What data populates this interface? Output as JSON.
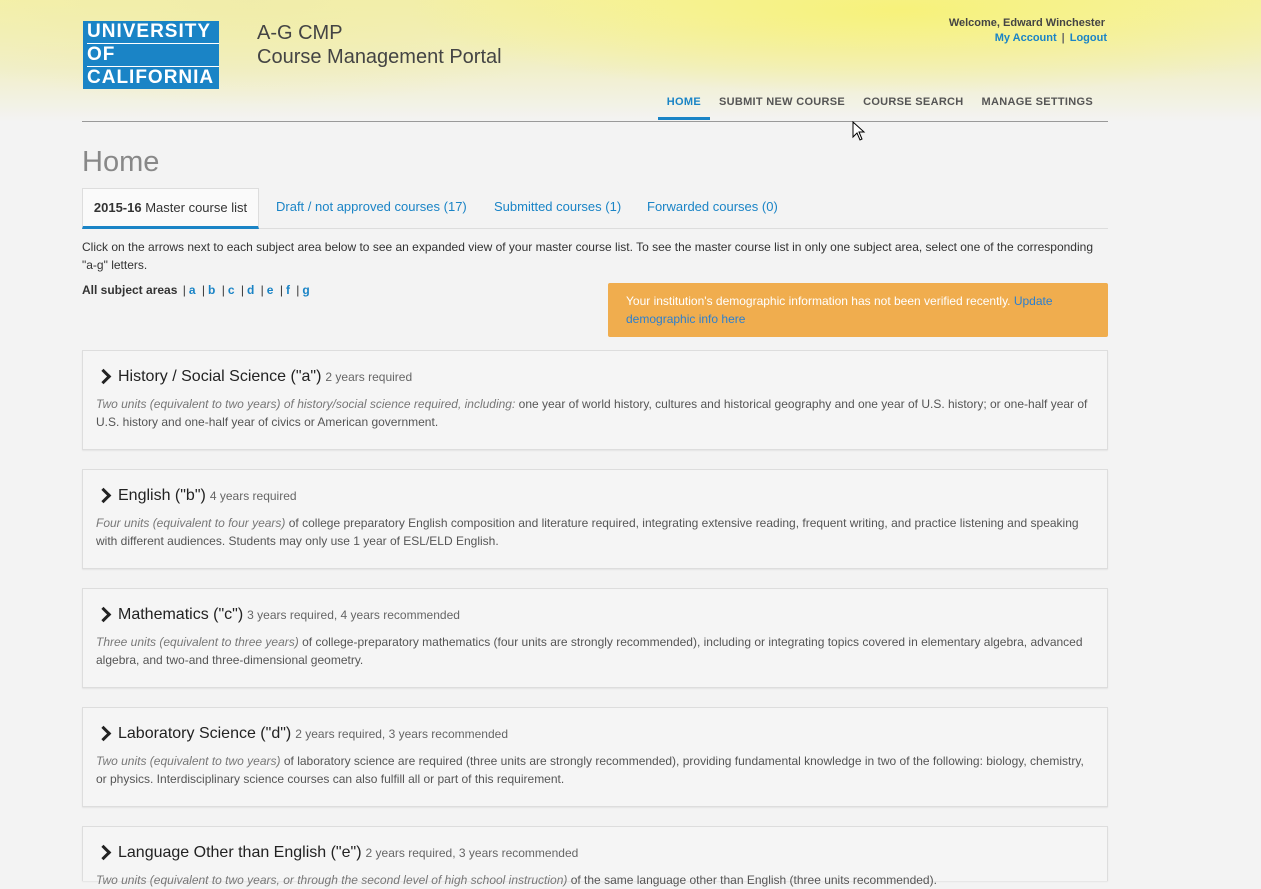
{
  "logo": {
    "lines": [
      "UNIVERSITY",
      "OF",
      "CALIFORNIA"
    ]
  },
  "app": {
    "title_line1": "A-G CMP",
    "title_line2": "Course Management Portal"
  },
  "user": {
    "welcome": "Welcome, Edward Winchester",
    "my_account": "My Account",
    "separator": "|",
    "logout": "Logout"
  },
  "nav": {
    "items": [
      "HOME",
      "SUBMIT NEW COURSE",
      "COURSE SEARCH",
      "MANAGE SETTINGS"
    ],
    "active": "HOME"
  },
  "page": {
    "title": "Home"
  },
  "tabs": [
    {
      "bold": "2015-16",
      "label": " Master course list",
      "active": true
    },
    {
      "label": "Draft / not approved courses (17)"
    },
    {
      "label": "Submitted courses (1)"
    },
    {
      "label": "Forwarded courses (0)"
    }
  ],
  "intro": "Click on the arrows next to each subject area below to see an expanded view of your master course list.  To see the master course list in only one subject area, select one of the corresponding \"a-g\" letters.",
  "filters": {
    "all_label": "All subject areas",
    "letters": [
      "a",
      "b",
      "c",
      "d",
      "e",
      "f",
      "g"
    ]
  },
  "alert": {
    "text": "Your institution's demographic information has not been verified recently. ",
    "link": "Update demographic info here"
  },
  "subjects": [
    {
      "name": "History / Social Science (\"a\")",
      "requirement": "2 years required",
      "desc_italic": "Two units (equivalent to two years) of history/social science required, including:",
      "desc_rest": " one year of world history, cultures and historical geography and one year of U.S. history; or one-half year of U.S. history and one-half year of civics or American government."
    },
    {
      "name": "English (\"b\")",
      "requirement": "4 years required",
      "desc_italic": "Four units (equivalent to four years)",
      "desc_rest": " of college preparatory English composition and literature required, integrating extensive reading, frequent writing, and practice listening and speaking with different audiences. Students may only use 1 year of ESL/ELD English."
    },
    {
      "name": "Mathematics (\"c\")",
      "requirement": "3 years required, 4 years recommended",
      "desc_italic": "Three units (equivalent to three years)",
      "desc_rest": " of college-preparatory mathematics (four units are strongly recommended), including or integrating topics covered in elementary algebra, advanced algebra, and two-and three-dimensional geometry."
    },
    {
      "name": "Laboratory Science (\"d\")",
      "requirement": "2 years required, 3 years recommended",
      "desc_italic": "Two units (equivalent to two years)",
      "desc_rest": " of laboratory science are required (three units are strongly recommended), providing fundamental knowledge in two of the following: biology, chemistry, or physics.  Interdisciplinary science courses can also fulfill all or part of this requirement."
    },
    {
      "name": "Language Other than English (\"e\")",
      "requirement": "2 years required, 3 years recommended",
      "desc_italic": "Two units (equivalent to two years, or through the second level of high school instruction)",
      "desc_rest": " of the same language other than English (three units recommended)."
    }
  ]
}
